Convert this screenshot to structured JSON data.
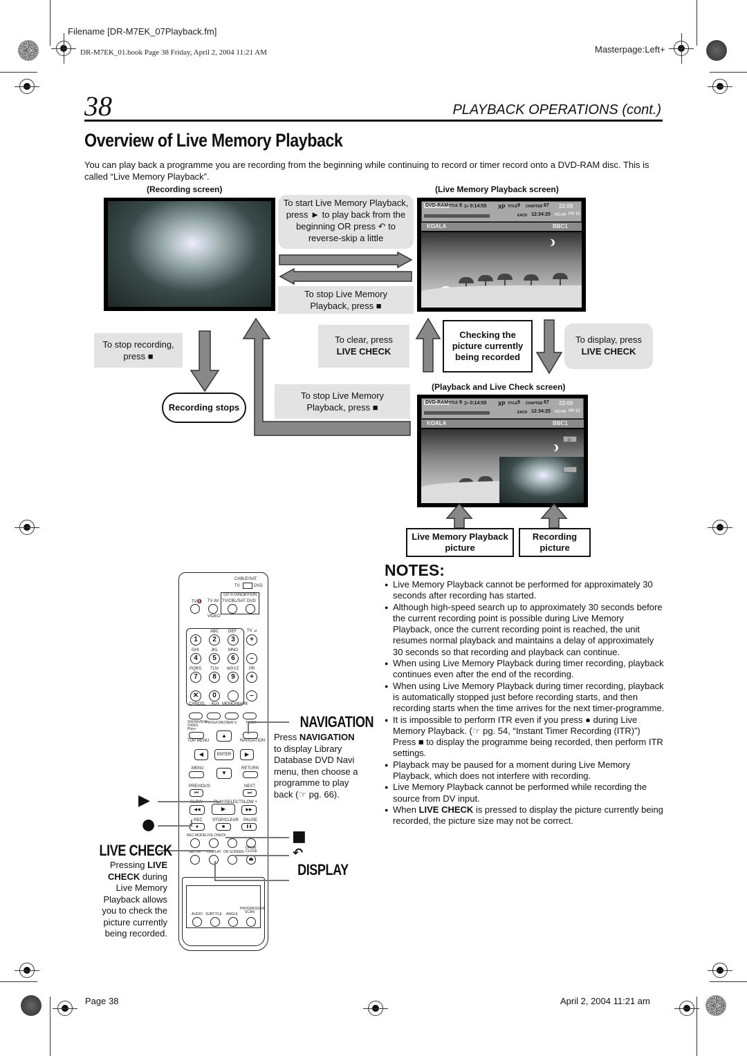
{
  "print_header": {
    "filename": "Filename [DR-M7EK_07Playback.fm]",
    "book_line": "DR-M7EK_01.book  Page 38  Friday, April 2, 2004  11:21 AM",
    "masterpage": "Masterpage:Left+"
  },
  "page": {
    "number": "38",
    "section": "PLAYBACK OPERATIONS (cont.)",
    "title": "Overview of Live Memory Playback",
    "intro": "You can play back a programme you are recording from the beginning while continuing to record or timer record onto a DVD-RAM disc. This is called “Live Memory Playback”."
  },
  "diagram": {
    "recording_screen_caption": "(Recording screen)",
    "lmp_screen_caption": "(Live Memory Playback screen)",
    "plc_screen_caption": "(Playback and Live Check screen)",
    "start_lmp": [
      "To start Live Memory Playback,",
      "press ► to play back from the",
      "beginning OR press ↶ to",
      "reverse-skip a little"
    ],
    "stop_lmp_top": [
      "To stop Live Memory",
      "Playback, press ■"
    ],
    "stop_recording": [
      "To stop recording,",
      "press ■"
    ],
    "recording_stops": "Recording stops",
    "stop_lmp_bottom": [
      "To stop Live Memory",
      "Playback, press ■"
    ],
    "to_clear": [
      "To clear, press",
      "LIVE CHECK"
    ],
    "checking_picture": [
      "Checking the",
      "picture currently",
      "being recorded"
    ],
    "to_display": [
      "To display, press",
      "LIVE CHECK"
    ],
    "lmp_picture_label": [
      "Live Memory Playback",
      "picture"
    ],
    "recording_picture_label": [
      "Recording",
      "picture"
    ],
    "osd": {
      "disc": "DVD-RAM",
      "title_label": "TITLE",
      "title_num": "9",
      "elapsed": "▷ 0:14:55",
      "mode": "XP",
      "title2_label": "TITLE",
      "title2_num": "9",
      "chapter_label": "CHAPTER",
      "chapter_num": "67",
      "each_label": "EACH",
      "each_time": "12:34:25",
      "clock": "22:00",
      "audio": "NICAM",
      "pr": "PR 12",
      "programme": "KOALA",
      "channel": "BBC1"
    }
  },
  "remote": {
    "cable_sat": "CABLE/SAT",
    "tv": "TV",
    "dvd": "DVD",
    "standby": "⏻/I STANDBY/ON",
    "tv_mute": "TV🔇",
    "tv_av": "TV AV",
    "tv_cbl_sat": "TV/CBL/SAT",
    "dvd_btn": "DVD",
    "video": "VIDEO",
    "keys": [
      {
        "num": "1",
        "letters": ""
      },
      {
        "num": "2",
        "letters": "ABC"
      },
      {
        "num": "3",
        "letters": "DEF"
      },
      {
        "num": "4",
        "letters": "GHI"
      },
      {
        "num": "5",
        "letters": "JKL"
      },
      {
        "num": "6",
        "letters": "MNO"
      },
      {
        "num": "7",
        "letters": "PQRS"
      },
      {
        "num": "8",
        "letters": "TUV"
      },
      {
        "num": "9",
        "letters": "WXYZ"
      }
    ],
    "tv_vol": "TV ⊿",
    "pr": "PR",
    "plus": "+",
    "minus": "–",
    "cancel_key": "✕",
    "zero_key": "0",
    "cancel": "CANCEL",
    "aux": "AUX",
    "memo_mark": "MEMO/MARK",
    "showview": "SHOWVIEW VIDEO Plus+",
    "progcheck": "PROG/CHECK",
    "sat": "SAT①",
    "timer": "TIMER",
    "top_menu": "TOP MENU",
    "navigation": "NAVIGATION",
    "up": "▲",
    "left": "◀",
    "enter": "ENTER",
    "right": "▶",
    "down": "▼",
    "menu": "MENU",
    "return": "RETURN",
    "previous": "PREVIOUS",
    "next": "NEXT",
    "prev_icon": "⏮",
    "next_icon": "⏭",
    "slow_minus": "SLOW –",
    "play_select": "PLAY/SELECT",
    "slow_plus": "SLOW +",
    "rew": "◀◀",
    "play": "▶",
    "ff": "▶▶",
    "rec": "REC",
    "stop_clear": "STOP/CLEAR",
    "pause": "PAUSE",
    "rec_dot": "●",
    "stop_sq": "■",
    "pause_bars": "❚❚",
    "rec_mode": "REC MODE",
    "live_check": "LIVE CHECK",
    "set_up": "SET UP",
    "display": "DISPLAY",
    "on_screen": "ON SCREEN",
    "open_close": "OPEN/ CLOSE",
    "eject": "⏏",
    "audio": "AUDIO",
    "subtitle": "SUBTITLE",
    "angle": "ANGLE",
    "progressive": "PROGRESSIVE SCAN"
  },
  "callouts": {
    "play_symbol": "▶",
    "rec_symbol": "●",
    "live_check_title": "LIVE CHECK",
    "live_check_desc": [
      {
        "text": "Pressing ",
        "bold": "LIVE"
      },
      {
        "text": "",
        "bold": "CHECK",
        "after": " during"
      },
      "Live Memory",
      "Playback allows",
      "you to check the",
      "picture currently",
      "being recorded."
    ],
    "live_check_line1a": "Pressing ",
    "live_check_line1b": "LIVE",
    "live_check_line2a": "CHECK",
    "live_check_line2b": " during",
    "live_check_line3": "Live Memory",
    "live_check_line4": "Playback allows",
    "live_check_line5": "you to check the",
    "live_check_line6": "picture currently",
    "live_check_line7": "being recorded.",
    "navigation_title": "NAVIGATION",
    "nav_line1a": "Press ",
    "nav_line1b": "NAVIGATION",
    "nav_line2": "to display Library",
    "nav_line3": "Database DVD Navi",
    "nav_line4": "menu, then choose a",
    "nav_line5": "programme to play",
    "nav_line6": "back (☞ pg. 66).",
    "stop_symbol": "■",
    "skip_symbol": "↶",
    "display_title": "DISPLAY"
  },
  "notes": {
    "title": "NOTES:",
    "items": [
      "Live Memory Playback cannot be performed for approximately 30 seconds after recording has started.",
      "Although high-speed search up to approximately 30 seconds before the current recording point is possible during Live Memory Playback, once the current recording point is reached, the unit resumes normal playback and maintains a delay of approximately 30 seconds so that recording and playback can continue.",
      "When using Live Memory Playback during timer recording, playback continues even after the end of the recording.",
      "When using Live Memory Playback during timer recording, playback is automatically stopped just before recording starts, and then recording starts when the time arrives for the next timer-programme.",
      "It is impossible to perform ITR even if you press ● during Live Memory Playback. (☞ pg. 54, “Instant Timer Recording (ITR)”)",
      "Playback may be paused for a moment during Live Memory Playback, which does not interfere with recording.",
      "Live Memory Playback cannot be performed while recording the source from DV input."
    ],
    "itr_followup": "Press ■ to display the programme being recorded, then perform ITR settings.",
    "last_item_a": "When ",
    "last_item_b": "LIVE CHECK",
    "last_item_c": " is pressed to display the picture currently being recorded, the picture size may not be correct."
  },
  "footer": {
    "page": "Page 38",
    "date": "April 2, 2004 11:21 am"
  }
}
